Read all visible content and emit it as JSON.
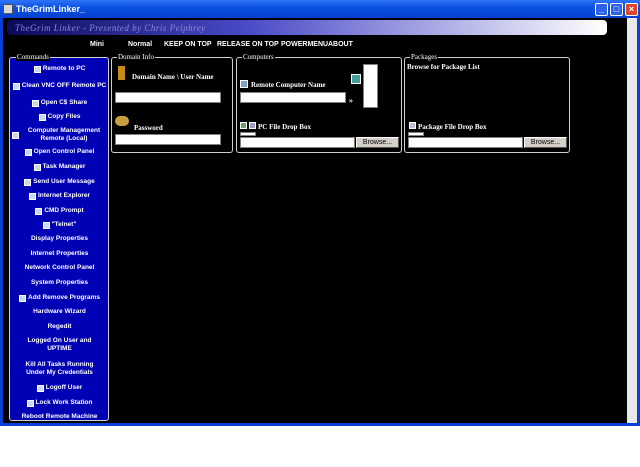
{
  "window": {
    "title": "TheGrimLinker_"
  },
  "banner": {
    "text": "TheGrim Linker - Presented by Chris Pelphrey"
  },
  "menu": [
    "Mini",
    "Normal",
    "KEEP ON TOP",
    "RELEASE ON TOP",
    "POWERMENU",
    "ABOUT"
  ],
  "commands": {
    "title": "Commands",
    "items": [
      "Remote to PC",
      "Clean VNC OFF Remote PC",
      "Open C$ Share",
      "Copy Files",
      "Computer Management Remote (Local)",
      "Open Control Panel",
      "Task Manager",
      "Send User Message",
      "Internet Explorer",
      "CMD Prompt",
      "\"Telnet\"",
      "Display Properties",
      "Internet Properties",
      "Network Control Panel",
      "System Properties",
      "Add Remove Programs",
      "Hardware Wizard",
      "Regedit",
      "Logged On User and UPTIME",
      "Kill All Tasks Running Under My Credentials",
      "Logoff User",
      "Lock Work Station",
      "Reboot Remote Machine"
    ]
  },
  "domain_info": {
    "title": "Domain Info",
    "user_label": "Domain Name \\ User Name",
    "password_label": "Password",
    "user_value": "",
    "password_value": ""
  },
  "computers": {
    "title": "Computers",
    "remote_label": "Remote Computer Name",
    "drop_label": "PC File Drop Box",
    "browse": "Browse..."
  },
  "packages": {
    "title": "Packages",
    "browse_list_label": "Browse for Package List",
    "drop_label": "Package File Drop Box",
    "browse": "Browse..."
  },
  "colors": {
    "commands_bg": "#0000b4",
    "window_bg": "#000000",
    "titlebar": "#0a4fe0"
  }
}
